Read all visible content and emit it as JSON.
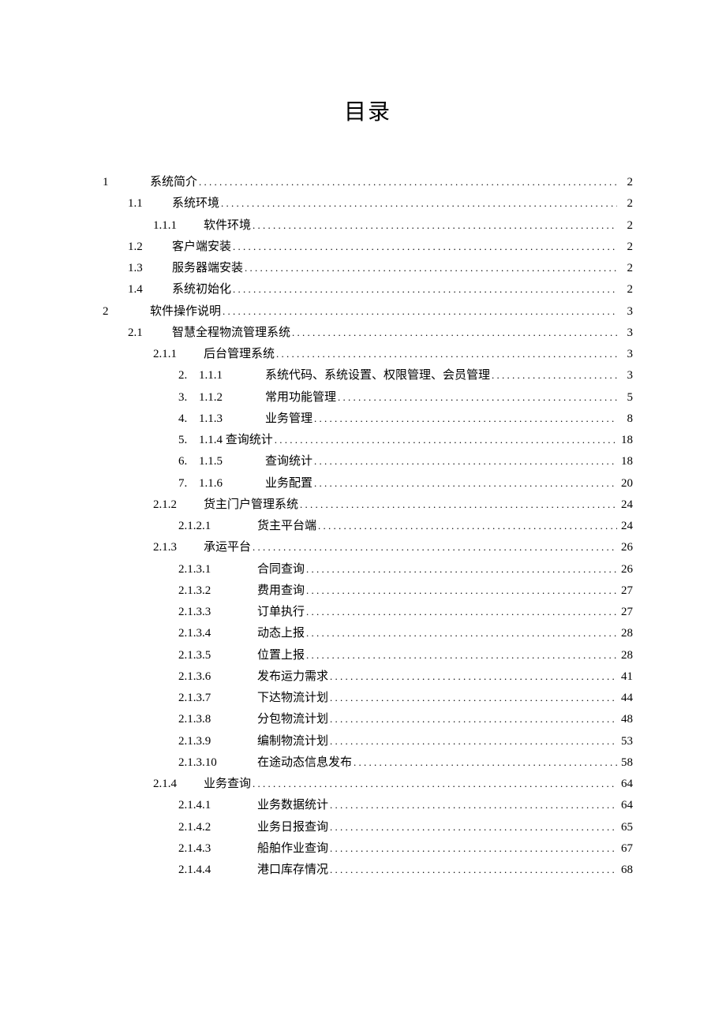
{
  "title": "目录",
  "toc": [
    {
      "indent": 0,
      "num": "1",
      "enum": "",
      "sub": "",
      "label": "系统简介",
      "page": "2"
    },
    {
      "indent": 1,
      "num": "1.1",
      "enum": "",
      "sub": "",
      "label": "系统环境",
      "page": "2"
    },
    {
      "indent": 2,
      "num": "1.1.1",
      "enum": "",
      "sub": "",
      "label": "软件环境",
      "page": "2"
    },
    {
      "indent": 1,
      "num": "1.2",
      "enum": "",
      "sub": "",
      "label": "客户端安装",
      "page": "2"
    },
    {
      "indent": 1,
      "num": "1.3",
      "enum": "",
      "sub": "",
      "label": "服务器端安装",
      "page": "2"
    },
    {
      "indent": 1,
      "num": "1.4",
      "enum": "",
      "sub": "",
      "label": "系统初始化",
      "page": "2"
    },
    {
      "indent": 0,
      "num": "2",
      "enum": "",
      "sub": "",
      "label": "软件操作说明",
      "page": "3"
    },
    {
      "indent": 1,
      "num": "2.1",
      "enum": "",
      "sub": "",
      "label": "智慧全程物流管理系统",
      "page": "3"
    },
    {
      "indent": 2,
      "num": "2.1.1",
      "enum": "",
      "sub": "",
      "label": "后台管理系统",
      "page": "3"
    },
    {
      "indent": 3,
      "num": "",
      "enum": "2.",
      "sub": "1.1.1",
      "label": "系统代码、系统设置、权限管理、会员管理",
      "page": "3"
    },
    {
      "indent": 3,
      "num": "",
      "enum": "3.",
      "sub": "1.1.2",
      "label": "常用功能管理",
      "page": "5"
    },
    {
      "indent": 3,
      "num": "",
      "enum": "4.",
      "sub": "1.1.3",
      "label": "业务管理",
      "page": "8"
    },
    {
      "indent": 3,
      "num": "",
      "enum": "5.",
      "sub": "",
      "label": "1.1.4 查询统计",
      "page": "18"
    },
    {
      "indent": 3,
      "num": "",
      "enum": "6.",
      "sub": "1.1.5",
      "label": "查询统计",
      "page": "18"
    },
    {
      "indent": 3,
      "num": "",
      "enum": "7.",
      "sub": "1.1.6",
      "label": "业务配置",
      "page": "20"
    },
    {
      "indent": 2,
      "num": "2.1.2",
      "enum": "",
      "sub": "",
      "label": "货主门户管理系统",
      "page": "24"
    },
    {
      "indent": 4,
      "num": "",
      "enum": "",
      "sub": "2.1.2.1",
      "label": "货主平台端",
      "page": "24"
    },
    {
      "indent": 2,
      "num": "2.1.3",
      "enum": "",
      "sub": "",
      "label": "承运平台",
      "page": "26"
    },
    {
      "indent": 4,
      "num": "",
      "enum": "",
      "sub": "2.1.3.1",
      "label": "合同查询",
      "page": "26"
    },
    {
      "indent": 4,
      "num": "",
      "enum": "",
      "sub": "2.1.3.2",
      "label": "费用查询",
      "page": "27"
    },
    {
      "indent": 4,
      "num": "",
      "enum": "",
      "sub": "2.1.3.3",
      "label": "订单执行",
      "page": "27"
    },
    {
      "indent": 4,
      "num": "",
      "enum": "",
      "sub": "2.1.3.4",
      "label": "动态上报",
      "page": "28"
    },
    {
      "indent": 4,
      "num": "",
      "enum": "",
      "sub": "2.1.3.5",
      "label": "位置上报",
      "page": "28"
    },
    {
      "indent": 4,
      "num": "",
      "enum": "",
      "sub": "2.1.3.6",
      "label": "发布运力需求",
      "page": "41"
    },
    {
      "indent": 4,
      "num": "",
      "enum": "",
      "sub": "2.1.3.7",
      "label": "下达物流计划",
      "page": "44"
    },
    {
      "indent": 4,
      "num": "",
      "enum": "",
      "sub": "2.1.3.8",
      "label": "分包物流计划",
      "page": "48"
    },
    {
      "indent": 4,
      "num": "",
      "enum": "",
      "sub": "2.1.3.9",
      "label": "编制物流计划",
      "page": "53"
    },
    {
      "indent": 4,
      "num": "",
      "enum": "",
      "sub": "2.1.3.10",
      "label": "在途动态信息发布",
      "page": "58"
    },
    {
      "indent": 2,
      "num": "2.1.4",
      "enum": "",
      "sub": "",
      "label": "业务查询",
      "page": "64"
    },
    {
      "indent": 4,
      "num": "",
      "enum": "",
      "sub": "2.1.4.1",
      "label": "业务数据统计",
      "page": "64"
    },
    {
      "indent": 4,
      "num": "",
      "enum": "",
      "sub": "2.1.4.2",
      "label": "业务日报查询",
      "page": "65"
    },
    {
      "indent": 4,
      "num": "",
      "enum": "",
      "sub": "2.1.4.3",
      "label": "船舶作业查询",
      "page": "67"
    },
    {
      "indent": 4,
      "num": "",
      "enum": "",
      "sub": "2.1.4.4",
      "label": "港口库存情况",
      "page": "68"
    }
  ]
}
